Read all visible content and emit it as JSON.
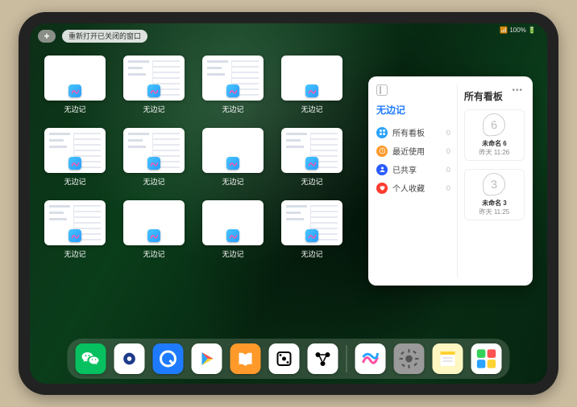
{
  "status": "📶 100% 🔋",
  "topbar": {
    "plus": "+",
    "pill_label": "重新打开已关闭的窗口"
  },
  "app_label": "无边记",
  "windows": [
    {
      "variant": false
    },
    {
      "variant": true
    },
    {
      "variant": true
    },
    {
      "variant": false
    },
    {
      "variant": true
    },
    {
      "variant": true
    },
    {
      "variant": false
    },
    {
      "variant": true
    },
    {
      "variant": true
    },
    {
      "variant": false
    },
    {
      "variant": false
    },
    {
      "variant": true
    }
  ],
  "panel": {
    "left_title": "无边记",
    "right_title": "所有看板",
    "items": [
      {
        "label": "所有看板",
        "count": 0,
        "color": "#2aa3ff",
        "icon": "grid"
      },
      {
        "label": "最近使用",
        "count": 0,
        "color": "#ff9a2a",
        "icon": "clock"
      },
      {
        "label": "已共享",
        "count": 0,
        "color": "#2a5bff",
        "icon": "person"
      },
      {
        "label": "个人收藏",
        "count": 0,
        "color": "#ff3b30",
        "icon": "heart"
      }
    ],
    "boards": [
      {
        "glyph": "6",
        "title": "未命名 6",
        "sub": "昨天 11:26"
      },
      {
        "glyph": "3",
        "title": "未命名 3",
        "sub": "昨天 11:25"
      }
    ]
  },
  "dock": [
    {
      "name": "wechat",
      "bg": "#07c160",
      "glyph": "wechat"
    },
    {
      "name": "browser1",
      "bg": "#ffffff",
      "glyph": "circle-blue"
    },
    {
      "name": "browser2",
      "bg": "#1e7bff",
      "glyph": "q"
    },
    {
      "name": "play",
      "bg": "#ffffff",
      "glyph": "play"
    },
    {
      "name": "books",
      "bg": "#ff9a2a",
      "glyph": "books"
    },
    {
      "name": "dice",
      "bg": "#ffffff",
      "glyph": "dice"
    },
    {
      "name": "nodes",
      "bg": "#ffffff",
      "glyph": "nodes"
    },
    {
      "name": "freeform",
      "bg": "#ffffff",
      "glyph": "freeform"
    },
    {
      "name": "settings",
      "bg": "#9a9a9a",
      "glyph": "gear"
    },
    {
      "name": "notes",
      "bg": "#fff7c2",
      "glyph": "notes"
    },
    {
      "name": "library",
      "bg": "#ffffff",
      "glyph": "library"
    }
  ]
}
